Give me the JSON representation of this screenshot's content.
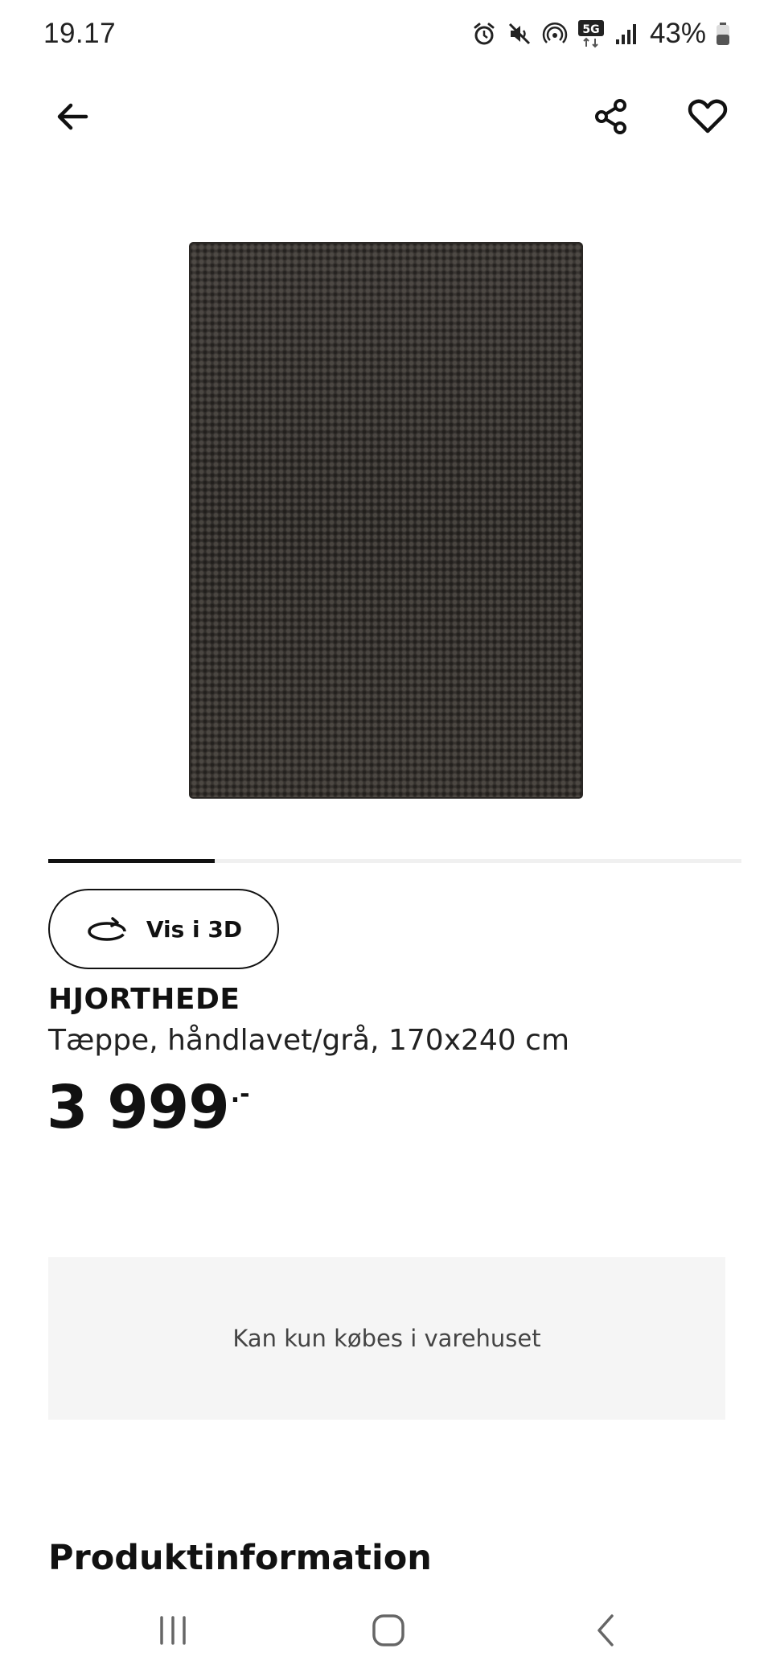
{
  "status_bar": {
    "time": "19.17",
    "network": "5G",
    "battery": "43%",
    "icons": [
      "alarm-icon",
      "mute-icon",
      "hotspot-icon",
      "5g-icon",
      "signal-icon",
      "battery-icon"
    ]
  },
  "nav": {
    "icons": [
      "back-arrow-icon",
      "share-icon",
      "heart-icon"
    ]
  },
  "carousel": {
    "current_index": 1,
    "progress_fraction": 0.24
  },
  "product": {
    "view_3d_label": "Vis i 3D",
    "name": "HJORTHEDE",
    "description": "Tæppe, håndlavet/grå, 170x240 cm",
    "price": "3 999",
    "price_suffix": ".-"
  },
  "availability": {
    "text": "Kan kun købes i varehuset"
  },
  "section": {
    "title": "Produktinformation"
  },
  "system_nav": {
    "icons": [
      "recents-icon",
      "home-icon",
      "back-icon"
    ]
  },
  "colors": {
    "text": "#111111",
    "panel": "#f5f5f5",
    "rug": "#33302d"
  }
}
